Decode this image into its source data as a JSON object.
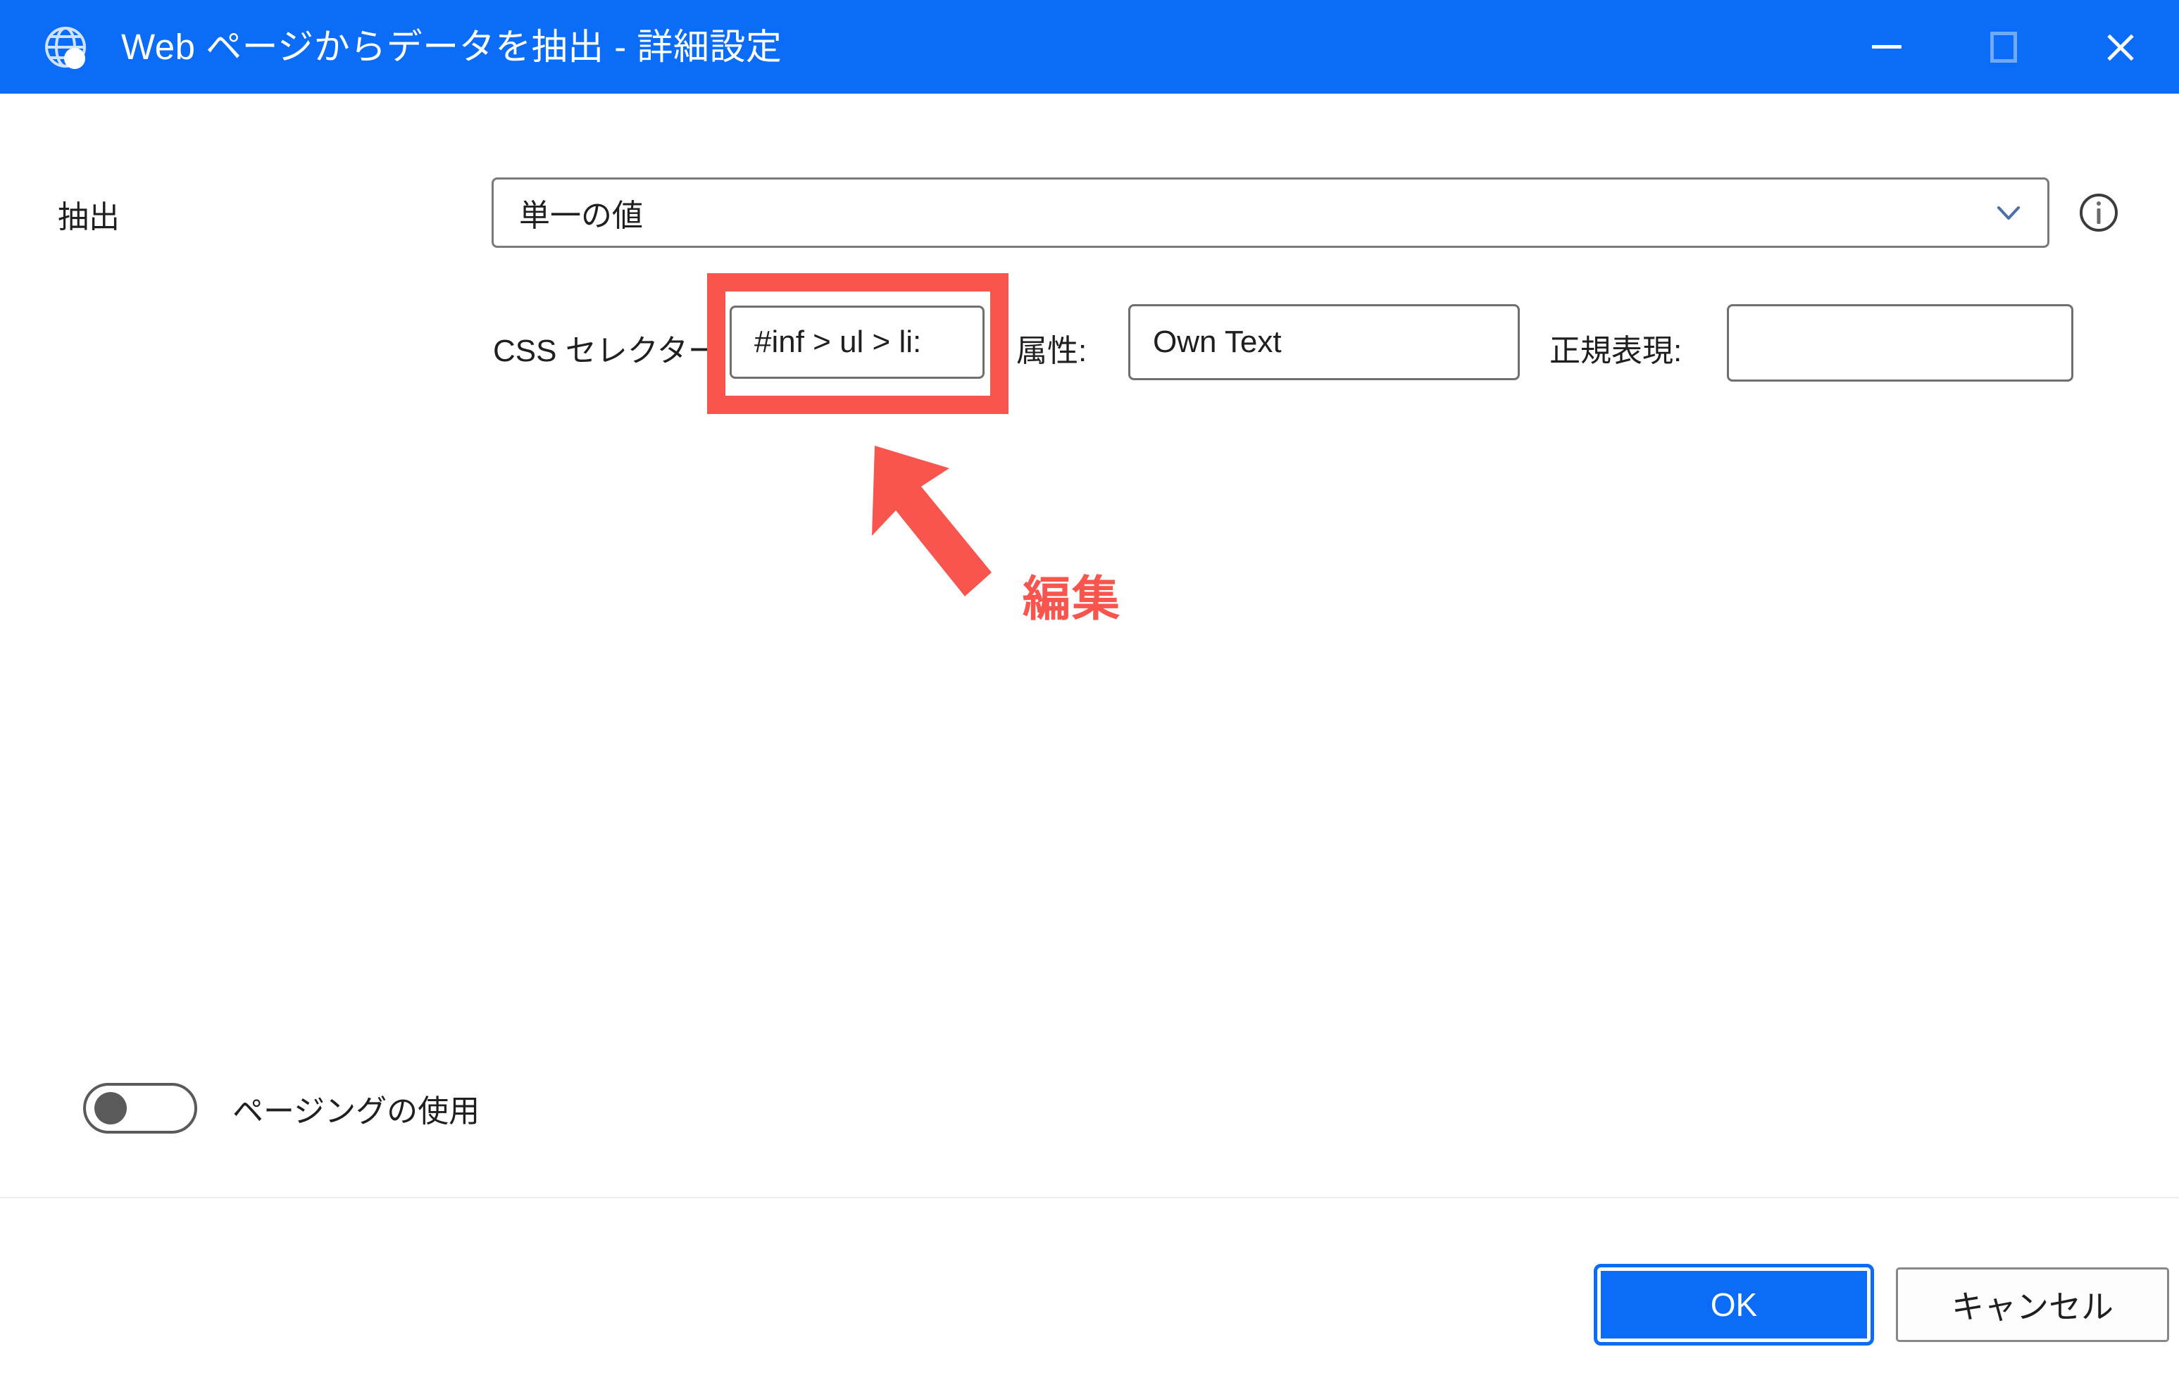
{
  "window": {
    "title": "Web ページからデータを抽出 - 詳細設定",
    "icon": "globe-icon",
    "accent_color": "#0a6cf7",
    "controls": {
      "minimize": "minimize-icon",
      "maximize": "maximize-icon",
      "close": "close-icon"
    }
  },
  "form": {
    "extract": {
      "label": "抽出",
      "value": "単一の値",
      "chevron": "chevron-down-icon",
      "info": "info-icon"
    },
    "css_selector": {
      "label": "CSS セレクター:",
      "value": "#inf > ul > li:",
      "placeholder": ""
    },
    "attribute": {
      "label": "属性:",
      "value": "Own Text",
      "placeholder": ""
    },
    "regex": {
      "label": "正規表現:",
      "value": "",
      "placeholder": ""
    },
    "paging": {
      "label": "ページングの使用",
      "state": "off"
    }
  },
  "annotation": {
    "color": "#f9554f",
    "text": "編集",
    "arrow": "arrow-up-left-icon",
    "target": "css-selector-input"
  },
  "footer": {
    "ok_label": "OK",
    "cancel_label": "キャンセル"
  }
}
